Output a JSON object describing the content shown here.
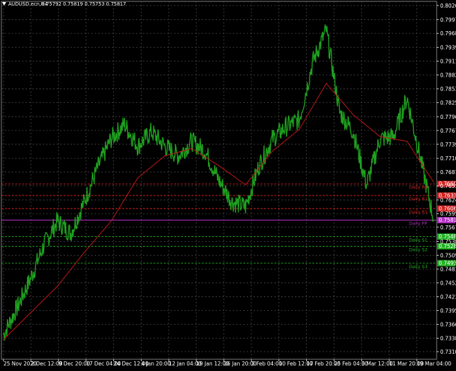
{
  "window": {
    "title": "AUDUSD.ecn,H4",
    "ohlc": "0.75792 0.75819 0.75753 0.75817"
  },
  "colors": {
    "background": "#000000",
    "grid": "#4a4a4a",
    "price_line": "#1fa01f",
    "moving_average": "#c01818",
    "pivot": "#b030c0",
    "resistance": "#d02020",
    "support": "#20b020",
    "axis_text": "#ffffff"
  },
  "chart_data": {
    "type": "line",
    "title": "AUDUSD.ecn,H4",
    "xlabel": "",
    "ylabel": "",
    "ylim": [
      0.73,
      0.8035
    ],
    "grid": true,
    "x_ticks": [
      "25 Nov 2020",
      "2 Dec 12:00",
      "9 Dec 20:00",
      "17 Dec 04:00",
      "24 Dec 12:00",
      "4 Jan 20:00",
      "12 Jan 04:00",
      "19 Jan 12:00",
      "26 Jan 20:00",
      "3 Feb 04:00",
      "10 Feb 12:00",
      "17 Feb 20:00",
      "25 Feb 04:00",
      "3 Mar 12:00",
      "11 Mar 20:00",
      "19 Mar 04:00"
    ],
    "y_ticks": [
      "0.80260",
      "0.79970",
      "0.79685",
      "0.79395",
      "0.79110",
      "0.78825",
      "0.78535",
      "0.78250",
      "0.77960",
      "0.77675",
      "0.77390",
      "0.77100",
      "0.76815",
      "0.76530",
      "0.76240",
      "0.75955",
      "0.75675",
      "0.75380",
      "0.75095",
      "0.74810",
      "0.74525",
      "0.74235",
      "0.73950",
      "0.73665",
      "0.73380",
      "0.73100"
    ],
    "series": [
      {
        "type": "price",
        "x": [
          "25 Nov 2020",
          "2 Dec 12:00",
          "5 Dec",
          "9 Dec 20:00",
          "13 Dec",
          "17 Dec 04:00",
          "20 Dec",
          "24 Dec 12:00",
          "28 Dec",
          "31 Dec",
          "4 Jan 20:00",
          "8 Jan",
          "12 Jan 04:00",
          "15 Jan",
          "19 Jan 12:00",
          "22 Jan",
          "26 Jan 20:00",
          "29 Jan",
          "3 Feb 04:00",
          "6 Feb",
          "10 Feb 12:00",
          "14 Feb",
          "17 Feb 20:00",
          "21 Feb",
          "25 Feb 04:00",
          "27 Feb",
          "3 Mar 12:00",
          "7 Mar",
          "11 Mar 20:00",
          "15 Mar",
          "19 Mar 04:00",
          "21 Mar",
          "24 Mar"
        ],
        "values": [
          0.7345,
          0.74,
          0.746,
          0.753,
          0.758,
          0.7555,
          0.762,
          0.769,
          0.775,
          0.778,
          0.7735,
          0.7765,
          0.7735,
          0.7715,
          0.7745,
          0.7725,
          0.7665,
          0.762,
          0.761,
          0.7695,
          0.775,
          0.7775,
          0.779,
          0.791,
          0.7975,
          0.7805,
          0.7765,
          0.7655,
          0.775,
          0.7755,
          0.7835,
          0.771,
          0.7582
        ]
      },
      {
        "type": "moving_average",
        "x": [
          "25 Nov 2020",
          "2 Dec 12:00",
          "9 Dec 20:00",
          "17 Dec 04:00",
          "24 Dec 12:00",
          "4 Jan 20:00",
          "12 Jan 04:00",
          "19 Jan 12:00",
          "26 Jan 20:00",
          "3 Feb 04:00",
          "10 Feb 12:00",
          "17 Feb 20:00",
          "25 Feb 04:00",
          "3 Mar 12:00",
          "11 Mar 20:00",
          "19 Mar 04:00",
          "24 Mar"
        ],
        "values": [
          0.7335,
          0.739,
          0.7445,
          0.7515,
          0.758,
          0.767,
          0.7715,
          0.773,
          0.7695,
          0.7655,
          0.7725,
          0.777,
          0.7865,
          0.78,
          0.7755,
          0.7745,
          0.766
        ]
      }
    ],
    "levels": [
      {
        "name": "Daily R3",
        "label": "Daily R3",
        "value": 0.7657,
        "color": "#d02020",
        "tag": "0.76600"
      },
      {
        "name": "Daily R2",
        "label": "Daily R2",
        "value": 0.7633,
        "color": "#d02020",
        "tag": "0.76330"
      },
      {
        "name": "Daily R1",
        "label": "Daily R1",
        "value": 0.7606,
        "color": "#d02020",
        "tag": "0.76060"
      },
      {
        "name": "Daily PP",
        "label": "Daily PP",
        "value": 0.7582,
        "color": "#b030c0",
        "tag": "0.75817"
      },
      {
        "name": "Daily S1",
        "label": "Daily S1",
        "value": 0.7548,
        "color": "#20b020",
        "tag": "0.75480"
      },
      {
        "name": "Daily S2",
        "label": "Daily S2",
        "value": 0.7528,
        "color": "#20b020",
        "tag": "0.75280"
      },
      {
        "name": "Daily S3",
        "label": "Daily S3",
        "value": 0.7493,
        "color": "#20b020",
        "tag": "0.74930"
      }
    ]
  }
}
